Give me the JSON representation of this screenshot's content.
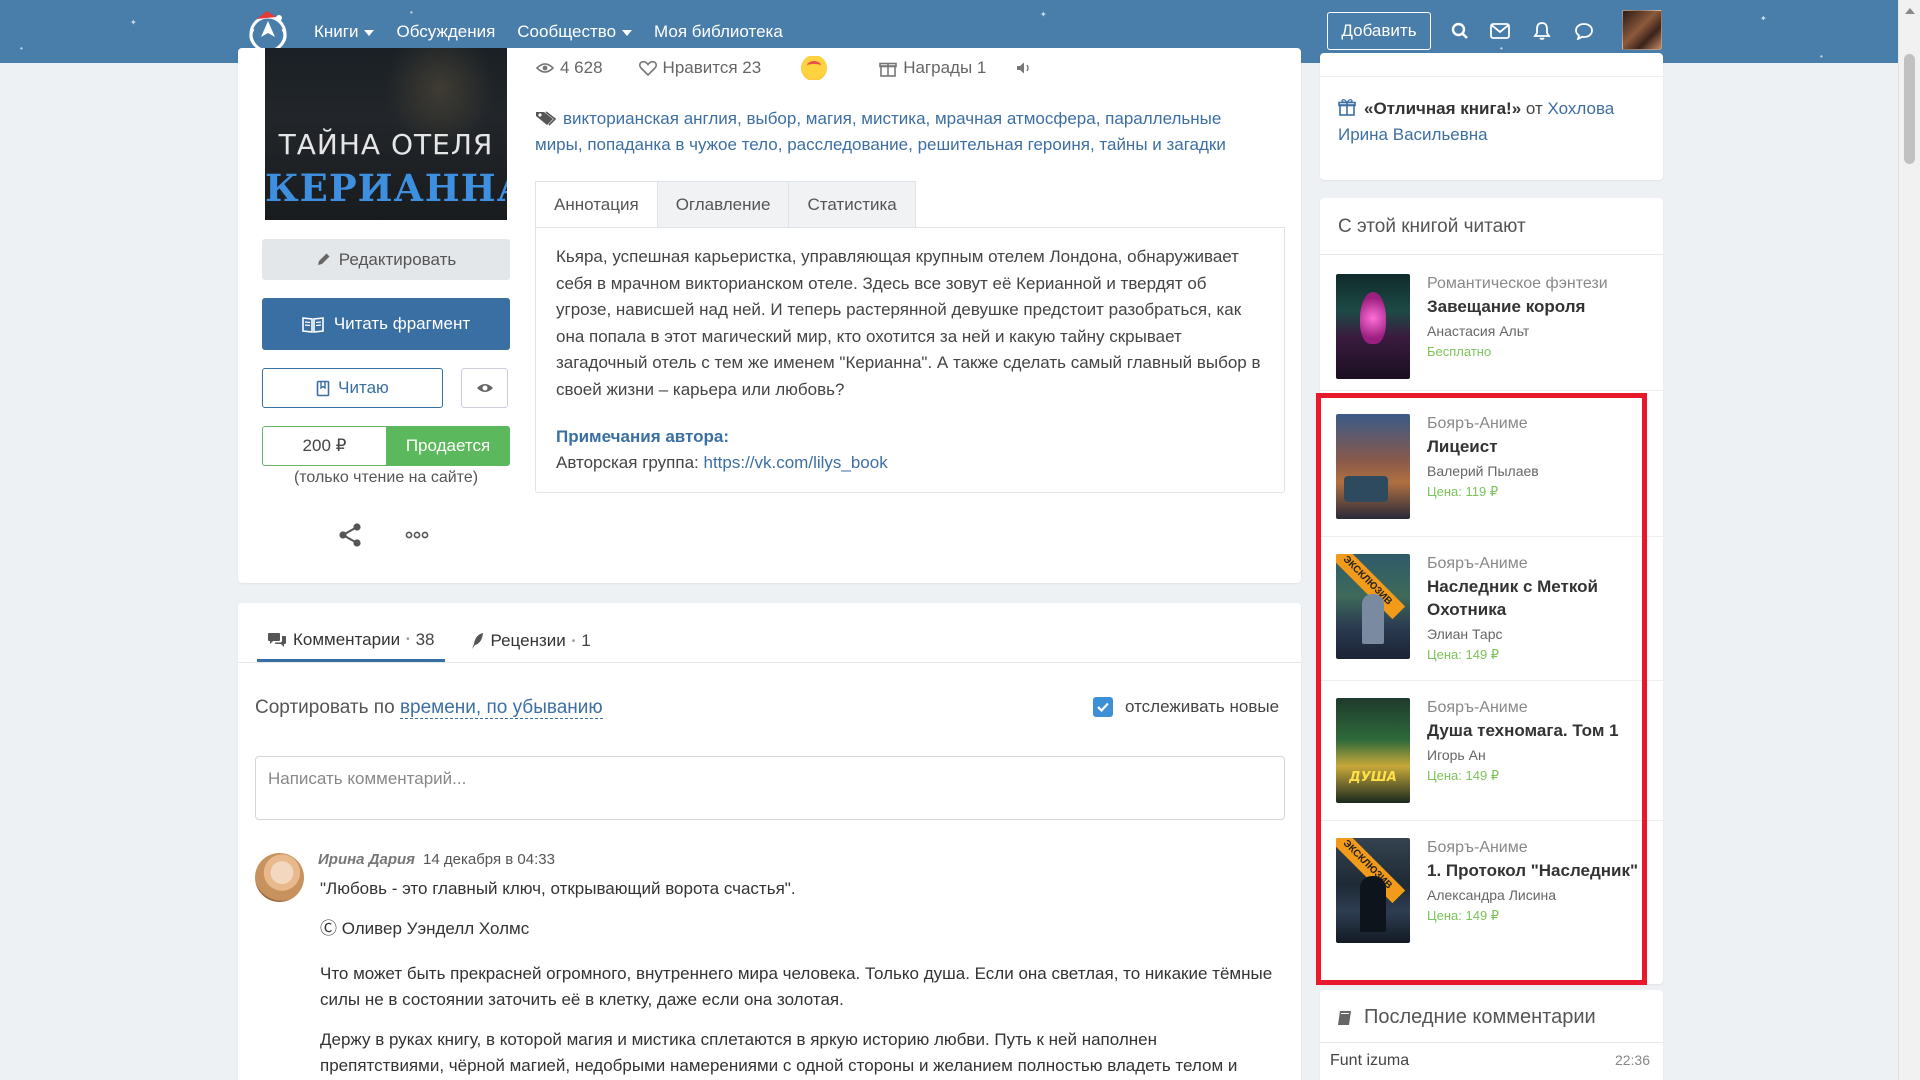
{
  "header": {
    "nav": [
      "Книги",
      "Обсуждения",
      "Сообщество",
      "Моя библиотека"
    ],
    "add_label": "Добавить",
    "icons": [
      "search-icon",
      "mail-icon",
      "bell-icon",
      "chat-icon"
    ]
  },
  "book": {
    "cover_line1": "ТАЙНА ОТЕЛЯ",
    "cover_line2": "КЕРИАННА",
    "stats": {
      "views": "4 628",
      "likes": "Нравится 23",
      "awards": "Награды 1"
    },
    "tags": [
      "викторианская англия",
      "выбор",
      "магия",
      "мистика",
      "мрачная атмосфера",
      "параллельные миры",
      "попаданка в чужое тело",
      "расследование",
      "решительная героиня",
      "тайны и загадки"
    ],
    "edit_label": "Редактировать",
    "read_label": "Читать фрагмент",
    "reading_label": "Читаю",
    "price": "200 ₽",
    "status": "Продается",
    "price_note": "(только чтение на сайте)",
    "tabs": [
      "Аннотация",
      "Оглавление",
      "Статистика"
    ],
    "annotation": "Кьяра, успешная карьеристка, управляющая крупным отелем Лондона, обнаруживает себя в мрачном викторианском отеле. Здесь все зовут её Керианной и твердят об угрозе, нависшей над ней. И теперь растерянной девушке предстоит разобраться, как она попала в этот магический мир, кто охотится за ней и какую тайну скрывает загадочный отель с тем же именем \"Керианна\". А также сделать самый главный выбор в своей жизни – карьера или любовь?",
    "notes_title": "Примечания автора:",
    "notes_prefix": "Авторская группа: ",
    "notes_link": "https://vk.com/lilys_book"
  },
  "comments": {
    "tab_comments": "Комментарии",
    "comments_count": "38",
    "tab_reviews": "Рецензии",
    "reviews_count": "1",
    "sort_prefix": "Сортировать по ",
    "sort_value": "времени, по убыванию",
    "track_label": "отслеживать новые",
    "input_placeholder": "Написать комментарий...",
    "first": {
      "author": "Ирина Дария",
      "date": "14 декабря в 04:33",
      "line1": "\"Любовь - это главный ключ, открывающий ворота счастья\".",
      "line2": "Ⓒ Оливер Уэнделл Холмс",
      "line3": "Что может быть прекрасней огромного, внутреннего мира человека. Только душа. Если она светлая, то никакие тёмные силы не в состоянии заточить её в клетку, даже если она золотая.",
      "line4": "Держу в руках книгу, в которой магия и мистика сплетаются в яркую историю любви. Путь к ней наполнен препятствиями, чёрной магией, недобрыми намерениями с одной стороны и желанием полностью владеть телом и душой с"
    }
  },
  "sidebar": {
    "award_title": "«Отличная книга!»",
    "award_from": " от ",
    "award_user": "Хохлова Ирина Васильевна",
    "reads_title": "С этой книгой читают",
    "books": [
      {
        "genre": "Романтическое фэнтези",
        "title": "Завещание короля",
        "author": "Анастасия Альт",
        "price": "Бесплатно"
      },
      {
        "genre": "Бояръ-Аниме",
        "title": "Лицеист",
        "author": "Валерий Пылаев",
        "price": "Цена: 119 ₽"
      },
      {
        "genre": "Бояръ-Аниме",
        "title": "Наследник с Меткой Охотника",
        "author": "Элиан Тарс",
        "price": "Цена: 149 ₽",
        "badge": "ЭКСКЛЮЗИВ"
      },
      {
        "genre": "Бояръ-Аниме",
        "title": "Душа техномага. Том 1",
        "author": "Игорь Ан",
        "price": "Цена: 149 ₽"
      },
      {
        "genre": "Бояръ-Аниме",
        "title": "1. Протокол \"Наследник\"",
        "author": "Александра Лисина",
        "price": "Цена: 149 ₽",
        "badge": "ЭКСКЛЮЗИВ"
      }
    ],
    "last_title": "Последние комментарии",
    "last_user": "Funt izuma",
    "last_time": "22:36"
  },
  "colors": {
    "header": "#4a7eaa",
    "accent": "#3a6fa3",
    "price_green": "#5cb85c",
    "highlight": "#e8192c"
  }
}
